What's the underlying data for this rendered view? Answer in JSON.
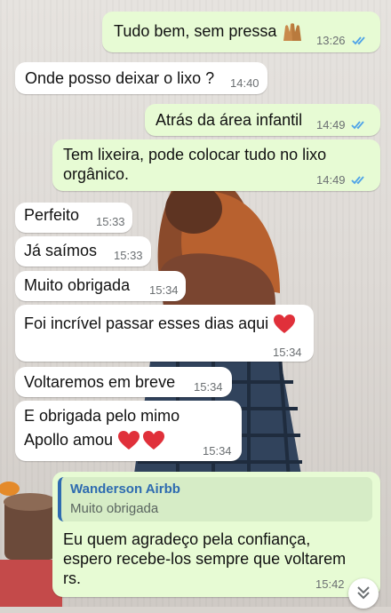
{
  "chat": {
    "messages": [
      {
        "text": "Tudo bem, sem pressa",
        "emoji": "raised-hands-emoji",
        "time": "13:26",
        "status": "read"
      },
      {
        "text": "Onde posso deixar o lixo ?",
        "time": "14:40"
      },
      {
        "text": "Atrás da área infantil",
        "time": "14:49",
        "status": "read"
      },
      {
        "line1": "Tem lixeira, pode colocar tudo no lixo",
        "line2": "orgânico.",
        "time": "14:49",
        "status": "read"
      },
      {
        "text": "Perfeito",
        "time": "15:33"
      },
      {
        "text": "Já saímos",
        "time": "15:33"
      },
      {
        "text": "Muito obrigada",
        "time": "15:34"
      },
      {
        "text": "Foi incrível passar esses dias aqui",
        "emoji": "red-heart-emoji",
        "time": "15:34"
      },
      {
        "text": "Voltaremos em breve",
        "time": "15:34"
      },
      {
        "line1": "E obrigada pelo mimo",
        "line2": "Apollo amou",
        "emoji": "two-red-hearts-emoji",
        "time": "15:34"
      },
      {
        "quote": {
          "author": "Wanderson Airbb",
          "text": "Muito obrigada"
        },
        "line1": "Eu quem agradeço pela confiança,",
        "line2": "espero recebe-los sempre que voltarem",
        "line3": "rs.",
        "time": "15:42"
      }
    ],
    "scroll_down_icon": "double-chevron-down-icon"
  },
  "colors": {
    "incoming_bubble": "#ffffff",
    "outgoing_bubble": "#e7fbd4",
    "read_ticks": "#4fa3e8",
    "quote_accent": "#2e6bb0",
    "heart": "#e0303a"
  }
}
